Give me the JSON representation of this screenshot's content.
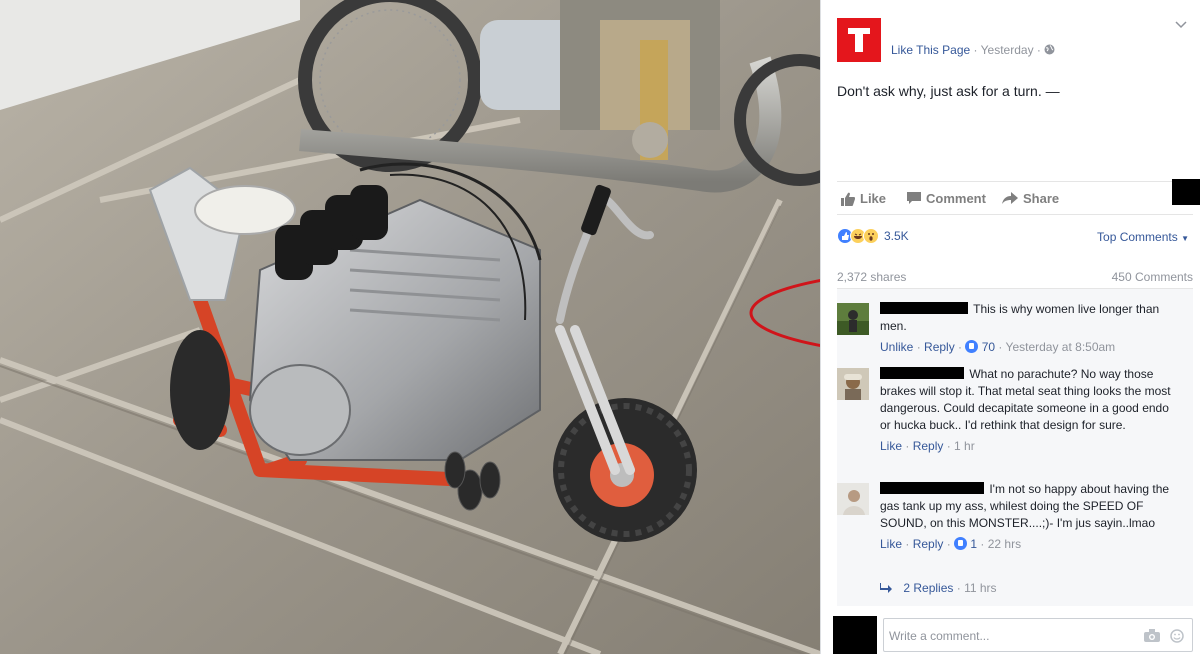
{
  "post": {
    "page_link": "Like This Page",
    "separator": "·",
    "timestamp": "Yesterday",
    "privacy_icon": "globe-icon",
    "text": "Don't ask why, just ask for a turn. —",
    "brand_color": "#e4161c"
  },
  "actions": {
    "like": "Like",
    "comment": "Comment",
    "share": "Share"
  },
  "reactions": {
    "count": "3.5K",
    "icons": [
      "like-icon",
      "haha-icon",
      "wow-icon"
    ],
    "sort_label": "Top Comments"
  },
  "stats": {
    "shares": "2,372 shares",
    "comments": "450 Comments"
  },
  "comments": [
    {
      "text": "This is why women live longer than men.",
      "like_action": "Unlike",
      "reply_action": "Reply",
      "likes": "70",
      "time": "Yesterday at 8:50am"
    },
    {
      "text": "What no parachute? No way those brakes will stop it. That metal seat thing looks the most dangerous. Could decapitate someone in a good endo or hucka buck.. I'd rethink that design for sure.",
      "like_action": "Like",
      "reply_action": "Reply",
      "time": "1 hr"
    },
    {
      "text": "I'm not so happy about having the gas tank up my ass, whilest doing the SPEED OF SOUND, on this MONSTER....;)- I'm jus sayin..lmao",
      "like_action": "Like",
      "reply_action": "Reply",
      "likes": "1",
      "time": "22 hrs"
    }
  ],
  "replies": {
    "label": "2 Replies",
    "time": "11 hrs"
  },
  "composer": {
    "placeholder": "Write a comment..."
  },
  "colors": {
    "link": "#365899",
    "muted": "#90949c",
    "highlight_oval": "#d0141a"
  }
}
